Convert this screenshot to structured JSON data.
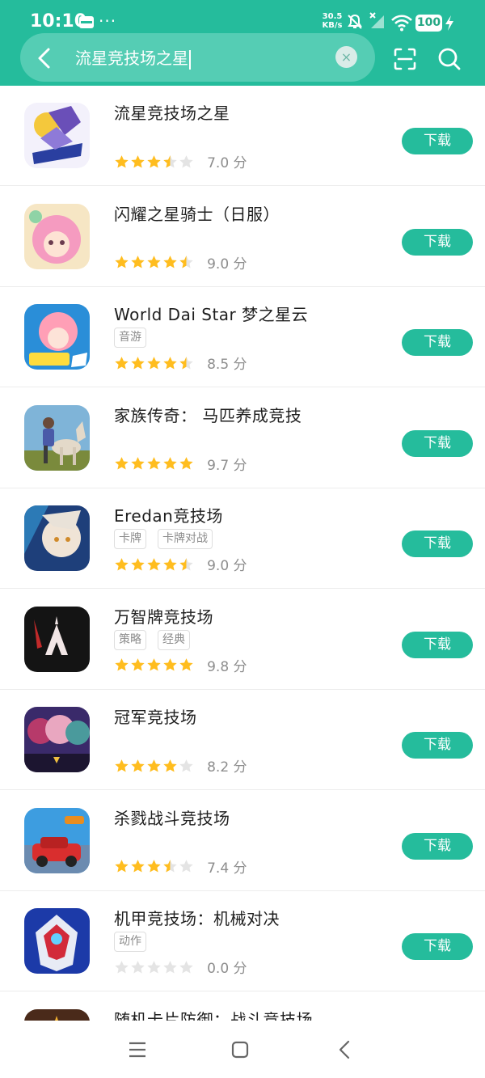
{
  "status_bar": {
    "time": "10:10",
    "more": "···",
    "net_speed_value": "30.5",
    "net_speed_unit": "KB/s",
    "battery": "100"
  },
  "search": {
    "query": "流星竞技场之星"
  },
  "buttons": {
    "download_label": "下载"
  },
  "apps": [
    {
      "name": "流星竞技场之星",
      "tags": [],
      "rating": 3.5,
      "score_text": "7.0 分",
      "icon": "meteor-arena-star-app-icon"
    },
    {
      "name": "闪耀之星骑士（日服）",
      "tags": [],
      "rating": 4.5,
      "score_text": "9.0 分",
      "icon": "shining-star-knight-app-icon"
    },
    {
      "name": "World Dai Star  梦之星云",
      "tags": [
        "音游"
      ],
      "rating": 4.5,
      "score_text": "8.5 分",
      "icon": "world-dai-star-app-icon"
    },
    {
      "name": "家族传奇：  马匹养成竞技",
      "tags": [],
      "rating": 5,
      "score_text": "9.7 分",
      "icon": "horse-family-legend-app-icon"
    },
    {
      "name": "Eredan竞技场",
      "tags": [
        "卡牌",
        "卡牌对战"
      ],
      "rating": 4.5,
      "score_text": "9.0 分",
      "icon": "eredan-arena-app-icon"
    },
    {
      "name": "万智牌竞技场",
      "tags": [
        "策略",
        "经典"
      ],
      "rating": 5,
      "score_text": "9.8 分",
      "icon": "mtg-arena-app-icon"
    },
    {
      "name": "冠军竞技场",
      "tags": [],
      "rating": 4,
      "score_text": "8.2 分",
      "icon": "champions-arena-app-icon"
    },
    {
      "name": "杀戮战斗竞技场",
      "tags": [],
      "rating": 3.5,
      "score_text": "7.4 分",
      "icon": "battle-cars-app-icon"
    },
    {
      "name": "机甲竞技场：机械对决",
      "tags": [
        "动作"
      ],
      "rating": 0,
      "score_text": "0.0 分",
      "icon": "mech-arena-app-icon"
    },
    {
      "name": "随机卡片防御：战斗竞技场",
      "tags": [],
      "rating": 0,
      "score_text": "",
      "icon": "random-card-defense-app-icon"
    }
  ],
  "colors": {
    "accent": "#25bc9c",
    "star_filled": "#ffbd1f",
    "star_empty": "#e4e4e4"
  }
}
